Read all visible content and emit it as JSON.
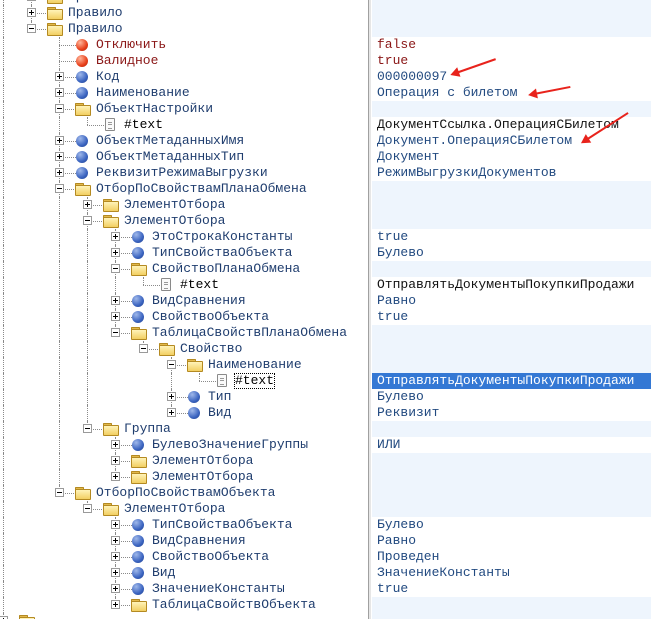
{
  "tree": {
    "rows": [
      {
        "level": 1,
        "icon": "folder",
        "name": "Правило",
        "toggle": "plus",
        "value": ""
      },
      {
        "level": 1,
        "icon": "folder",
        "name": "Правило",
        "toggle": "plus",
        "value": ""
      },
      {
        "level": 1,
        "icon": "folder",
        "name": "Правило",
        "toggle": "minus",
        "value": ""
      },
      {
        "level": 2,
        "icon": "red",
        "name": "Отключить",
        "toggle": "none",
        "value": "false",
        "vcolor": "red"
      },
      {
        "level": 2,
        "icon": "red",
        "name": "Валидное",
        "toggle": "none",
        "value": "true",
        "vcolor": "red"
      },
      {
        "level": 2,
        "icon": "blue",
        "name": "Код",
        "toggle": "plus",
        "value": "000000097",
        "vcolor": "blue"
      },
      {
        "level": 2,
        "icon": "blue",
        "name": "Наименование",
        "toggle": "plus",
        "value": "Операция с билетом",
        "vcolor": "blue"
      },
      {
        "level": 2,
        "icon": "folder",
        "name": "ОбъектНастройки",
        "toggle": "minus",
        "value": ""
      },
      {
        "level": 3,
        "icon": "doc",
        "name": "#text",
        "toggle": "none",
        "value": "ДокументСсылка.ОперацияСБилетом",
        "vcolor": "black"
      },
      {
        "level": 2,
        "icon": "blue",
        "name": "ОбъектМетаданныхИмя",
        "toggle": "plus",
        "value": "Документ.ОперацияСБилетом",
        "vcolor": "blue"
      },
      {
        "level": 2,
        "icon": "blue",
        "name": "ОбъектМетаданныхТип",
        "toggle": "plus",
        "value": "Документ",
        "vcolor": "blue"
      },
      {
        "level": 2,
        "icon": "blue",
        "name": "РеквизитРежимаВыгрузки",
        "toggle": "plus",
        "value": "РежимВыгрузкиДокументов",
        "vcolor": "blue"
      },
      {
        "level": 2,
        "icon": "folder",
        "name": "ОтборПоСвойствамПланаОбмена",
        "toggle": "minus",
        "value": ""
      },
      {
        "level": 3,
        "icon": "folder",
        "name": "ЭлементОтбора",
        "toggle": "plus",
        "value": ""
      },
      {
        "level": 3,
        "icon": "folder",
        "name": "ЭлементОтбора",
        "toggle": "minus",
        "value": ""
      },
      {
        "level": 4,
        "icon": "blue",
        "name": "ЭтоСтрокаКонстанты",
        "toggle": "plus",
        "value": "true",
        "vcolor": "blue"
      },
      {
        "level": 4,
        "icon": "blue",
        "name": "ТипСвойстваОбъекта",
        "toggle": "plus",
        "value": "Булево",
        "vcolor": "blue"
      },
      {
        "level": 4,
        "icon": "folder",
        "name": "СвойствоПланаОбмена",
        "toggle": "minus",
        "value": ""
      },
      {
        "level": 5,
        "icon": "doc",
        "name": "#text",
        "toggle": "none",
        "value": "ОтправлятьДокументыПокупкиПродажи",
        "vcolor": "black"
      },
      {
        "level": 4,
        "icon": "blue",
        "name": "ВидСравнения",
        "toggle": "plus",
        "value": "Равно",
        "vcolor": "blue"
      },
      {
        "level": 4,
        "icon": "blue",
        "name": "СвойствоОбъекта",
        "toggle": "plus",
        "value": "true",
        "vcolor": "blue"
      },
      {
        "level": 4,
        "icon": "folder",
        "name": "ТаблицаСвойствПланаОбмена",
        "toggle": "minus",
        "value": ""
      },
      {
        "level": 5,
        "icon": "folder",
        "name": "Свойство",
        "toggle": "minus",
        "value": ""
      },
      {
        "level": 6,
        "icon": "folder",
        "name": "Наименование",
        "toggle": "minus",
        "value": ""
      },
      {
        "level": 7,
        "icon": "doc",
        "name": "#text",
        "toggle": "none",
        "value": "ОтправлятьДокументыПокупкиПродажи",
        "vcolor": "black",
        "selected": true
      },
      {
        "level": 6,
        "icon": "blue",
        "name": "Тип",
        "toggle": "plus",
        "value": "Булево",
        "vcolor": "blue"
      },
      {
        "level": 6,
        "icon": "blue",
        "name": "Вид",
        "toggle": "plus",
        "value": "Реквизит",
        "vcolor": "blue"
      },
      {
        "level": 3,
        "icon": "folder",
        "name": "Группа",
        "toggle": "minus",
        "value": ""
      },
      {
        "level": 4,
        "icon": "blue",
        "name": "БулевоЗначениеГруппы",
        "toggle": "plus",
        "value": "ИЛИ",
        "vcolor": "blue"
      },
      {
        "level": 4,
        "icon": "folder",
        "name": "ЭлементОтбора",
        "toggle": "plus",
        "value": ""
      },
      {
        "level": 4,
        "icon": "folder",
        "name": "ЭлементОтбора",
        "toggle": "plus",
        "value": ""
      },
      {
        "level": 2,
        "icon": "folder",
        "name": "ОтборПоСвойствамОбъекта",
        "toggle": "minus",
        "value": ""
      },
      {
        "level": 3,
        "icon": "folder",
        "name": "ЭлементОтбора",
        "toggle": "minus",
        "value": ""
      },
      {
        "level": 4,
        "icon": "blue",
        "name": "ТипСвойстваОбъекта",
        "toggle": "plus",
        "value": "Булево",
        "vcolor": "blue"
      },
      {
        "level": 4,
        "icon": "blue",
        "name": "ВидСравнения",
        "toggle": "plus",
        "value": "Равно",
        "vcolor": "blue"
      },
      {
        "level": 4,
        "icon": "blue",
        "name": "СвойствоОбъекта",
        "toggle": "plus",
        "value": "Проведен",
        "vcolor": "blue"
      },
      {
        "level": 4,
        "icon": "blue",
        "name": "Вид",
        "toggle": "plus",
        "value": "ЗначениеКонстанты",
        "vcolor": "blue"
      },
      {
        "level": 4,
        "icon": "blue",
        "name": "ЗначениеКонстанты",
        "toggle": "plus",
        "value": "true",
        "vcolor": "blue"
      },
      {
        "level": 4,
        "icon": "folder",
        "name": "ТаблицаСвойствОбъекта",
        "toggle": "plus",
        "value": ""
      },
      {
        "level": 0,
        "icon": "folder",
        "name": "",
        "toggle": "plus",
        "value": ""
      }
    ]
  },
  "colors": {
    "selection": "#3478d4",
    "annotation_arrow": "#e8231c",
    "folder_row_bg": "#eef5fd"
  }
}
